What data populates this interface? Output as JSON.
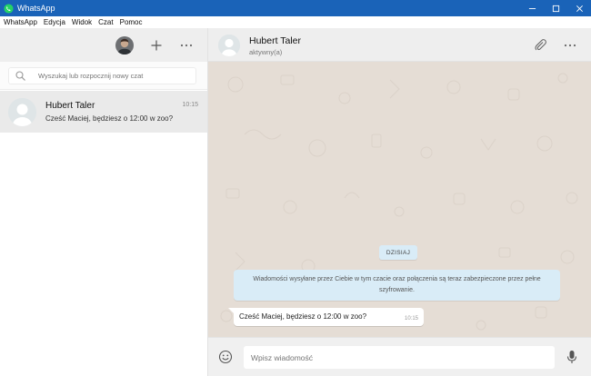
{
  "window": {
    "title": "WhatsApp",
    "accent_color": "#1a63b8",
    "controls": [
      "minimize-icon",
      "maximize-icon",
      "close-icon"
    ]
  },
  "menubar": {
    "items": [
      {
        "label": "WhatsApp"
      },
      {
        "label": "Edycja"
      },
      {
        "label": "Widok"
      },
      {
        "label": "Czat"
      },
      {
        "label": "Pomoc"
      }
    ]
  },
  "sidebar": {
    "header_icons": [
      "profile-avatar",
      "new-chat-icon",
      "more-icon"
    ],
    "search": {
      "placeholder": "Wyszukaj lub rozpocznij nowy czat"
    },
    "chats": [
      {
        "name": "Hubert Taler",
        "time": "10:15",
        "preview": "Cześć Maciej, będziesz o 12:00 w zoo?"
      }
    ]
  },
  "conversation": {
    "contact_name": "Hubert Taler",
    "contact_status": "aktywny(a)",
    "header_icons": [
      "attach-icon",
      "more-icon"
    ],
    "date_badge": "DZISIAJ",
    "encryption_notice": "Wiadomości wysyłane przez Ciebie w tym czacie oraz połączenia są teraz zabezpieczone przez pełne szyfrowanie.",
    "messages": [
      {
        "text": "Cześć Maciej, będziesz o 12:00 w zoo?",
        "time": "10:15",
        "direction": "incoming"
      }
    ],
    "composer": {
      "placeholder": "Wpisz wiadomość"
    },
    "colors": {
      "chat_background": "#e5ddd5",
      "system_bubble": "#d9ecf7",
      "incoming_bubble": "#ffffff"
    }
  }
}
